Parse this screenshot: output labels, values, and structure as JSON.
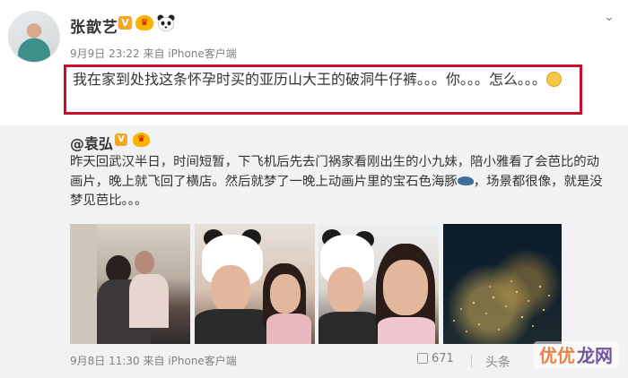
{
  "post": {
    "author": "张歆艺",
    "meta": "9月9日 23:22 来自 iPhone客户端",
    "text": "我在家到处找这条怀孕时买的亚历山大王的破洞牛仔裤。。。你。。。怎么。。。"
  },
  "repost": {
    "author": "@袁弘",
    "text": "昨天回武汉半日，时间短暂，下飞机后先去门祸家看刚出生的小九妹，陪小雅看了会芭比的动画片，晚上就飞回了横店。然后就梦了一晚上动画片里的宝石色海豚",
    "text_tail": "，场景都很像，就是没梦见芭比。。。",
    "meta": "9月8日 11:30 来自 iPhone客户端",
    "share_count": "671"
  },
  "badges": {
    "v_label": "V"
  },
  "watermark": {
    "text": "头条",
    "logo": "优优龙网"
  },
  "colors": {
    "highlight": "#c8102e",
    "card_bg": "#f2f2f5",
    "vip": "#f5a623"
  }
}
